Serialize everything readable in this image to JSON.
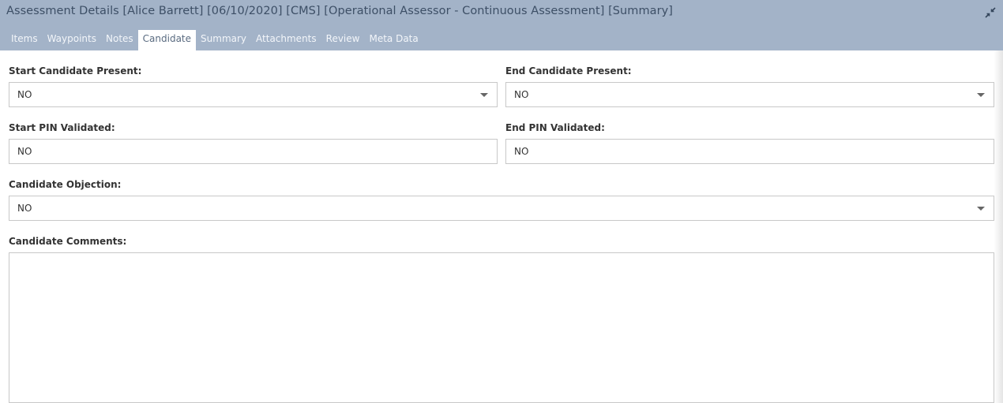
{
  "window": {
    "title": "Assessment Details [Alice Barrett] [06/10/2020] [CMS] [Operational Assessor - Continuous Assessment] [Summary]",
    "collapse_icon": "collapse-arrows-icon"
  },
  "tabs": [
    {
      "label": "Items"
    },
    {
      "label": "Waypoints"
    },
    {
      "label": "Notes"
    },
    {
      "label": "Candidate",
      "active": true
    },
    {
      "label": "Summary"
    },
    {
      "label": "Attachments"
    },
    {
      "label": "Review"
    },
    {
      "label": "Meta Data"
    }
  ],
  "form": {
    "start_candidate_present": {
      "label": "Start Candidate Present:",
      "value": "NO"
    },
    "end_candidate_present": {
      "label": "End Candidate Present:",
      "value": "NO"
    },
    "start_pin_validated": {
      "label": "Start PIN Validated:",
      "value": "NO"
    },
    "end_pin_validated": {
      "label": "End PIN Validated:",
      "value": "NO"
    },
    "candidate_objection": {
      "label": "Candidate Objection:",
      "value": "NO"
    },
    "candidate_comments": {
      "label": "Candidate Comments:",
      "value": ""
    }
  },
  "colors": {
    "header_bg": "#a3b3c8",
    "title_text": "#3d4f66",
    "tab_text": "#f3f6fa",
    "active_tab_text": "#5a6b80",
    "field_border": "#c8c8c8"
  }
}
